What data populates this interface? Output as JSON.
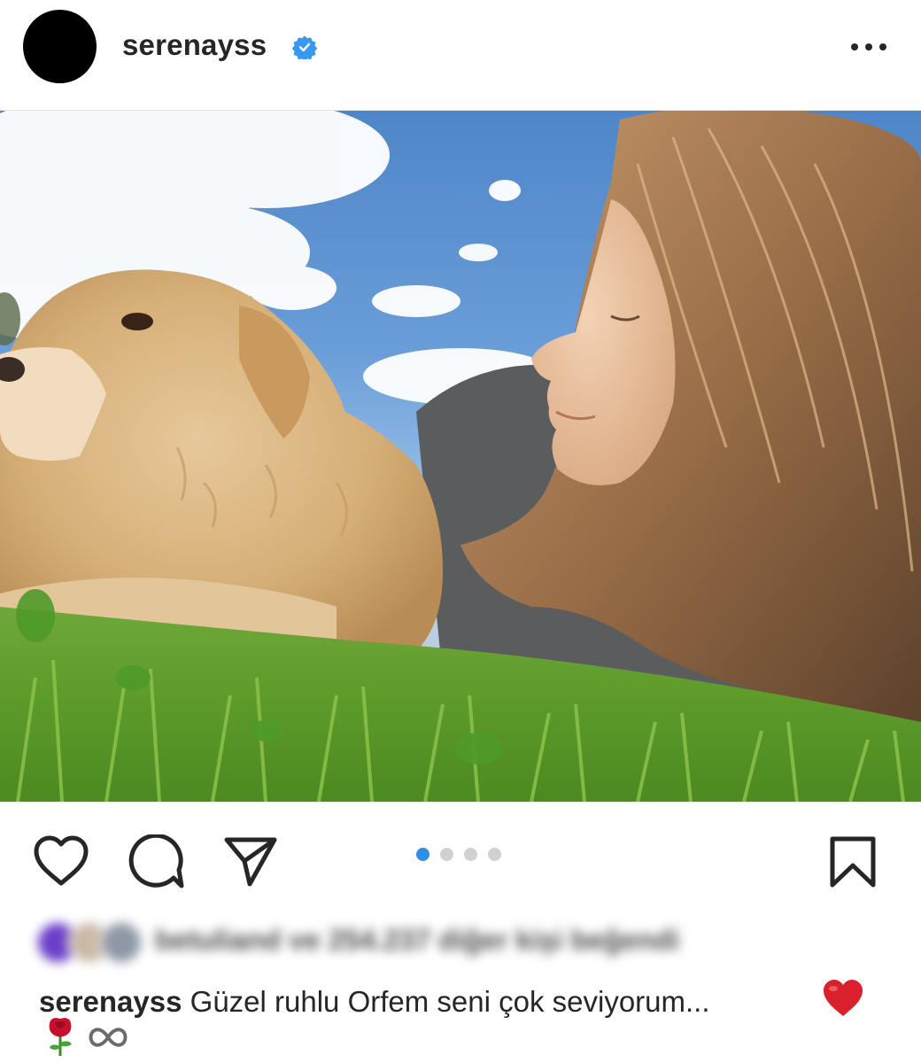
{
  "post": {
    "username": "serenayss",
    "verified": true,
    "more_icon": "ellipsis-icon",
    "photo_description_icon": "photo",
    "carousel": {
      "count": 4,
      "active_index": 0
    },
    "likes_text": "betuliand ve 254.237 diğer kişi beğendi",
    "caption": {
      "username": "serenayss",
      "text": "Güzel ruhlu Orfem seni çok seviyorum...",
      "emoji_end": "❤️",
      "line2_emojis": [
        "🌹",
        "♾"
      ]
    }
  },
  "colors": {
    "accent": "#2f8fe8",
    "verified": "#3897f0",
    "text": "#262626"
  },
  "icons": [
    "like-icon",
    "comment-icon",
    "share-icon",
    "save-icon"
  ]
}
